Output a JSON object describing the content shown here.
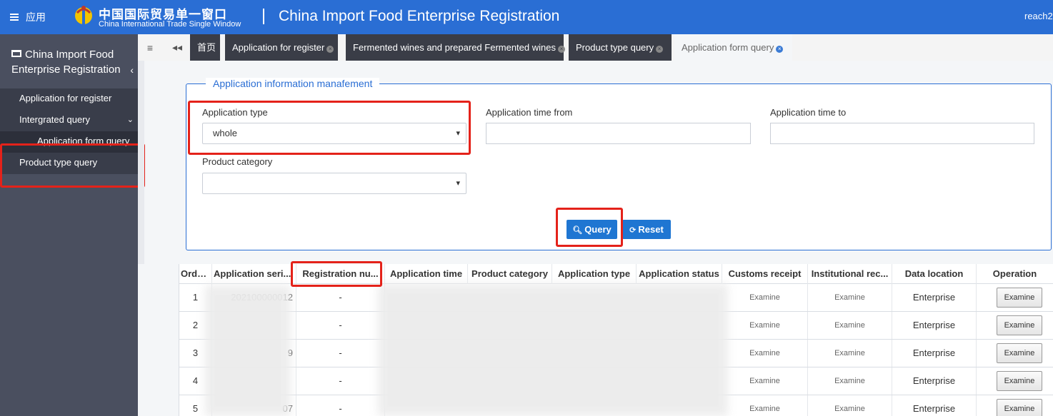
{
  "header": {
    "menu_label": "应用",
    "logo_cn": "中国国际贸易单一窗口",
    "logo_en": "China International Trade Single Window",
    "app_title": "China Import Food Enterprise Registration",
    "user": "reach2"
  },
  "sidebar": {
    "title": "China Import Food Enterprise Registration",
    "items": [
      {
        "label": "Application for register"
      },
      {
        "label": "Intergrated query"
      },
      {
        "label": "Application form query"
      },
      {
        "label": "Product type query"
      }
    ]
  },
  "tabs": [
    {
      "label": "首页"
    },
    {
      "label": "Application for register"
    },
    {
      "label": "Fermented wines and prepared Fermented wines"
    },
    {
      "label": "Product type query"
    },
    {
      "label": "Application form query"
    }
  ],
  "form": {
    "legend": "Application information manafement",
    "application_type_label": "Application type",
    "application_type_value": "whole",
    "time_from_label": "Application time from",
    "time_to_label": "Application time to",
    "product_category_label": "Product category",
    "query_label": "Query",
    "reset_label": "Reset"
  },
  "table": {
    "columns": [
      "Orde...",
      "Application seri...",
      "Registration nu...",
      "Application time",
      "Product category",
      "Application type",
      "Application status",
      "Customs receipt",
      "Institutional rec...",
      "Data location",
      "Operation"
    ],
    "rows": [
      {
        "order": "1",
        "serial_partial": "202100000012",
        "reg": "-",
        "customs": "Examine",
        "inst": "Examine",
        "location": "Enterprise",
        "op": "Examine"
      },
      {
        "order": "2",
        "serial_partial": "",
        "reg": "-",
        "customs": "Examine",
        "inst": "Examine",
        "location": "Enterprise",
        "op": "Examine"
      },
      {
        "order": "3",
        "serial_partial": "9",
        "reg": "-",
        "customs": "Examine",
        "inst": "Examine",
        "location": "Enterprise",
        "op": "Examine"
      },
      {
        "order": "4",
        "serial_partial": "",
        "reg": "-",
        "customs": "Examine",
        "inst": "Examine",
        "location": "Enterprise",
        "op": "Examine"
      },
      {
        "order": "5",
        "serial_partial": "07",
        "reg": "-",
        "customs": "Examine",
        "inst": "Examine",
        "location": "Enterprise",
        "op": "Examine"
      }
    ]
  },
  "colors": {
    "header_blue": "#2a6ed4",
    "highlight_red": "#e4221a",
    "button_blue": "#1f76d2",
    "sidebar_dark": "#4a4f5f"
  }
}
